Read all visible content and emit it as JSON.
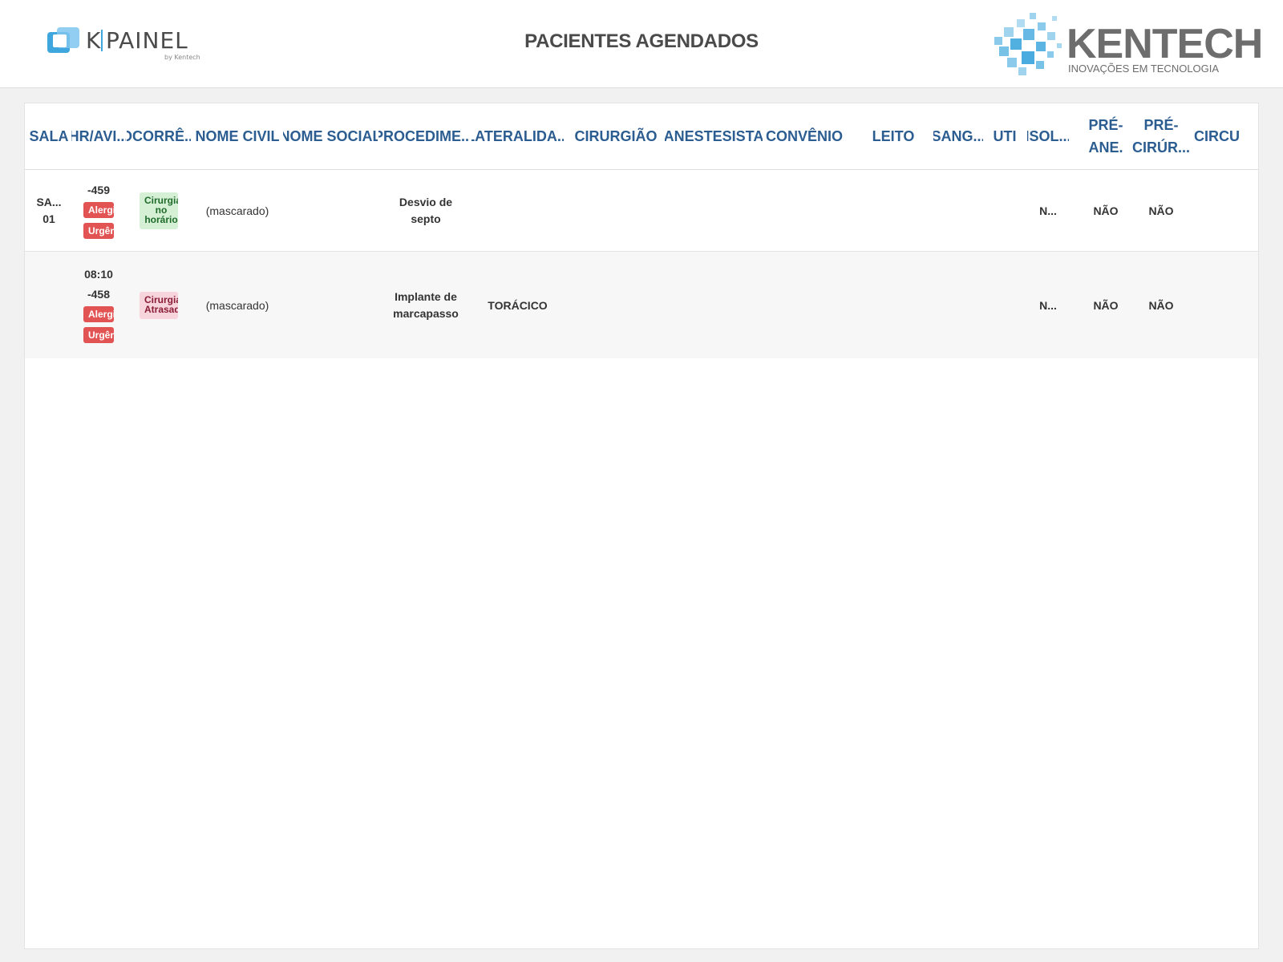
{
  "header": {
    "title": "PACIENTES AGENDADOS",
    "left_logo": {
      "text": "K PAINEL",
      "sub": "by Kentech"
    },
    "right_logo": {
      "text": "KENTECH",
      "sub": "INOVAÇÕES EM TECNOLOGIA"
    }
  },
  "table": {
    "columns": [
      "SALA",
      "HR/AVI...",
      "OCORRÊ...",
      "NOME CIVIL",
      "NOME SOCIAL",
      "PROCEDIME...",
      "LATERALIDA...",
      "CIRURGIÃO",
      "ANESTESISTA",
      "CONVÊNIO",
      "LEITO",
      "SANG...",
      "UTI",
      "ISOL...",
      "PRÉ-ANE.",
      "PRÉ-CIRÚR...",
      "CIRCU"
    ],
    "columns_display": {
      "pre_ane_line1": "PRÉ-",
      "pre_ane_line2": "ANE.",
      "pre_cir_line1": "PRÉ-",
      "pre_cir_line2": "CIRÚR..."
    },
    "rows": [
      {
        "sala_line1": "SA...",
        "sala_line2": "01",
        "hr_time": "",
        "hr_code": "-459",
        "badges": [
          "Alergia",
          "Urgência"
        ],
        "ocorrencia": "Cirurgia no horário",
        "ocorrencia_status": "green",
        "nome_civil": "(mascarado)",
        "nome_social": "",
        "procedimento": "Desvio de septo",
        "lateralidade": "",
        "isolamento": "N...",
        "pre_anestesico": "NÃO",
        "pre_cirurgico": "NÃO"
      },
      {
        "sala_line1": "",
        "sala_line2": "",
        "hr_time": "08:10",
        "hr_code": "-458",
        "badges": [
          "Alergia",
          "Urgência"
        ],
        "ocorrencia": "Cirurgia Atrasada",
        "ocorrencia_status": "red",
        "nome_civil": "(mascarado)",
        "nome_social": "",
        "procedimento": "Implante de marcapasso",
        "lateralidade": "TORÁCICO",
        "isolamento": "N...",
        "pre_anestesico": "NÃO",
        "pre_cirurgico": "NÃO"
      }
    ]
  },
  "colors": {
    "header_text": "#2c5d91",
    "title_text": "#4a4a4a",
    "badge_red": "#e25353",
    "occ_green_bg": "#d6f0d6",
    "occ_red_bg": "#f8d5dc"
  }
}
